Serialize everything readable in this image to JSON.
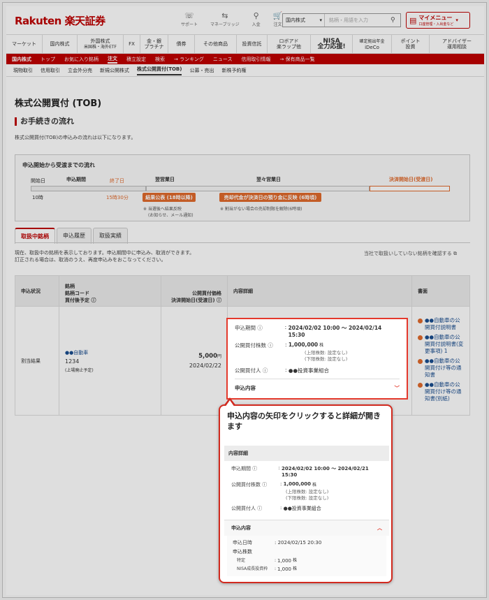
{
  "header": {
    "logo": "Rakuten 楽天証券",
    "icons": [
      {
        "name": "support",
        "label": "サポート",
        "glyph": "☏"
      },
      {
        "name": "market",
        "label": "マネーブリッジ",
        "glyph": "⇆"
      },
      {
        "name": "deposit",
        "label": "入金",
        "glyph": "⚲"
      },
      {
        "name": "order",
        "label": "注文",
        "glyph": "🛒"
      }
    ],
    "search_select": "国内株式",
    "search_placeholder": "銘柄・用語を入力",
    "mymenu": "マイメニュー",
    "mymenu_sub": "口座管理・入出金など"
  },
  "gnav": [
    {
      "label": "マーケット"
    },
    {
      "label": "国内株式"
    },
    {
      "label": "外国株式",
      "sub": "米国株・海外ETF"
    },
    {
      "label": "FX"
    },
    {
      "label": "金・銀",
      "sub": "プラチナ"
    },
    {
      "label": "債券"
    },
    {
      "label": "その他商品"
    },
    {
      "label": "投資信託"
    },
    {
      "label": "ロボアド",
      "sub": "楽ラップ他"
    },
    {
      "label": "NISA",
      "sub": "全力応援!"
    },
    {
      "label": "確定拠出年金",
      "sub": "iDeCo"
    },
    {
      "label": "ポイント",
      "sub": "投資"
    },
    {
      "label": "アドバイザー",
      "sub": "運用相談"
    }
  ],
  "rnav": [
    "国内株式",
    "トップ",
    "お気に入り銘柄",
    "注文",
    "積立設定",
    "検索",
    "→ ランキング",
    "ニュース",
    "信用取引情報",
    "→ 保有商品一覧"
  ],
  "snav": [
    "現物取引",
    "信用取引",
    "立会外分売",
    "新規公開株式",
    "株式公開買付(TOB)",
    "公募・売出",
    "新株予約権"
  ],
  "page_title": "株式公開買付 (TOB)",
  "section_title": "お手続きの流れ",
  "intro": "株式公開買付(TOB)の申込みの流れは以下になります。",
  "flow": {
    "title": "申込開始から受渡までの流れ",
    "c1": "開始日",
    "c2": "申込期間",
    "c2b": "終了日",
    "c3": "翌営業日",
    "c4": "翌々営業日",
    "c5": "決済開始日(受渡日)",
    "t1": "10時",
    "t2": "15時30分",
    "btn1": "結果公表 (18時以降)",
    "btn2": "売却代金が決済日の預り金に反映 (6時頃)",
    "n1": "※ 当選後へ結果反映",
    "n1b": "(お知らせ、メール通知)",
    "n2": "※ 割当がない場合の売却制限を解除(6時頃)"
  },
  "tabs": [
    "取扱中銘柄",
    "申込履歴",
    "取扱実績"
  ],
  "desc1": "現在、取扱中の銘柄を表示しております。申込期間中に申込み、取消ができます。",
  "desc2": "訂正される場合は、取消のうえ、再度申込みをおこなってください。",
  "right_link": "当社で取扱いしていない銘柄を確認する",
  "table": {
    "h1": "申込状況",
    "h2a": "銘柄",
    "h2b": "銘柄コード",
    "h2c": "買付後予定",
    "h3a": "公開買付価格",
    "h3b": "決済開始日(受渡日)",
    "h4": "内容詳細",
    "h5": "書面",
    "status": "割当結果",
    "stock": "●●自動車",
    "code": "1234",
    "plan": "(上場廃止予定)",
    "price": "5,000",
    "price_unit": "円",
    "settle": "2024/02/22",
    "docs": [
      "●●自動車の公開買付説明書",
      "●●自動車の公開買付説明書(変更事項) 1",
      "●●自動車の公開買付け等の通知書",
      "●●自動車の公開買付け等の通知書(別紙)"
    ]
  },
  "detail": {
    "k1": "申込期間",
    "v1": "2024/02/02 10:00 〜 2024/02/14 15:30",
    "k2": "公開買付株数",
    "v2": "1,000,000",
    "v2u": "株",
    "s1": "(上限株数: 設定なし)",
    "s2": "(下限株数: 設定なし)",
    "k3": "公開買付人",
    "v3": "●●投資事業組合",
    "k4": "申込内容"
  },
  "callout": {
    "text": "申込内容の矢印をクリックすると詳細が開きます",
    "ih": "内容詳細",
    "k1": "申込期間",
    "v1": "2024/02/02 10:00 〜 2024/02/21 15:30",
    "k2": "公開買付株数",
    "v2": "1,000,000",
    "v2u": "株",
    "s1": "(上限株数: 設定なし)",
    "s2": "(下限株数: 設定なし)",
    "k3": "公開買付人",
    "v3": "●●投資事業組合",
    "k4": "申込内容",
    "k5": "申込日時",
    "v5": "2024/02/15 20:30",
    "k6": "申込株数",
    "k7": "特定",
    "v7": "1,000",
    "k8": "NISA成長投資枠",
    "v8": "1,000",
    "unit": "株"
  },
  "colors": {
    "brand": "#bf0000",
    "orange": "#e06a2c",
    "highlight": "#e4392c"
  }
}
